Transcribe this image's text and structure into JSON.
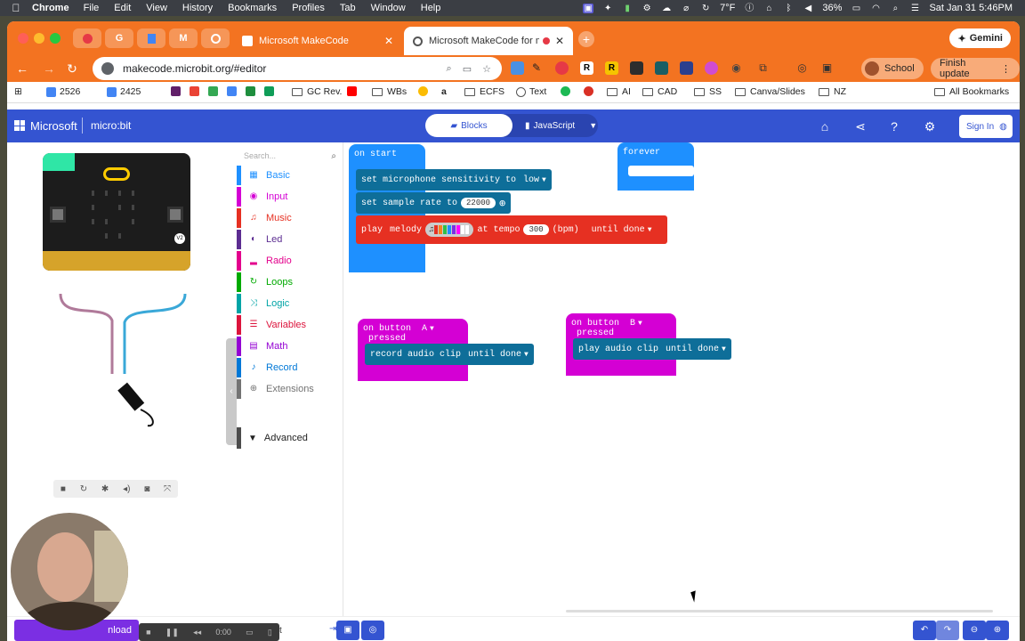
{
  "menubar": {
    "app": "Chrome",
    "menus": [
      "File",
      "Edit",
      "View",
      "History",
      "Bookmarks",
      "Profiles",
      "Tab",
      "Window",
      "Help"
    ],
    "weather": "7°F",
    "battery": "36%",
    "datetime": "Sat Jan 31  5:46PM"
  },
  "tabs": [
    {
      "label": "Microsoft MakeCode",
      "active": false
    },
    {
      "label": "Microsoft MakeCode for m",
      "active": true
    }
  ],
  "gemini_label": "Gemini",
  "address": {
    "url": "makecode.microbit.org/#editor",
    "profile_label": "School",
    "update_label": "Finish update"
  },
  "bookmarks": [
    {
      "label": "2526"
    },
    {
      "label": "2425"
    },
    {
      "label": "GC Rev."
    },
    {
      "label": "WBs"
    },
    {
      "label": "ECFS"
    },
    {
      "label": "Text"
    },
    {
      "label": "AI"
    },
    {
      "label": "CAD"
    },
    {
      "label": "SS"
    },
    {
      "label": "Canva/Slides"
    },
    {
      "label": "NZ"
    },
    {
      "label": "All Bookmarks"
    }
  ],
  "makecode": {
    "brand": "Microsoft",
    "product": "micro:bit",
    "blocks_label": "Blocks",
    "js_label": "JavaScript",
    "signin_label": "Sign In"
  },
  "toolbox": {
    "search_placeholder": "Search...",
    "categories": [
      {
        "label": "Basic",
        "color": "#1e90ff"
      },
      {
        "label": "Input",
        "color": "#d400d4"
      },
      {
        "label": "Music",
        "color": "#e63022"
      },
      {
        "label": "Led",
        "color": "#5c2d91"
      },
      {
        "label": "Radio",
        "color": "#e3008c"
      },
      {
        "label": "Loops",
        "color": "#00aa00"
      },
      {
        "label": "Logic",
        "color": "#00a4a6"
      },
      {
        "label": "Variables",
        "color": "#dc143c"
      },
      {
        "label": "Math",
        "color": "#9400d3"
      },
      {
        "label": "Record",
        "color": "#0078d7"
      },
      {
        "label": "Extensions",
        "color": "#737373"
      }
    ],
    "advanced_label": "Advanced"
  },
  "blocks": {
    "on_start": "on start",
    "mic_sensitivity": "set microphone sensitivity to",
    "mic_value": "low",
    "sample_rate": "set sample rate to",
    "sample_value": "22000",
    "play": "play",
    "melody": "melody",
    "at_tempo": "at tempo",
    "tempo_value": "300",
    "bpm": "(bpm)",
    "until_done": "until done",
    "forever": "forever",
    "on_button_a": "on button",
    "button_a": "A",
    "pressed": "pressed",
    "record_clip": "record audio clip",
    "on_button_b": "on button",
    "button_b": "B",
    "play_clip": "play audio clip"
  },
  "bottombar": {
    "download_label": "nload",
    "rec_time": "0:00",
    "project_name": "t"
  },
  "colors": {
    "chrome_orange": "#f37321",
    "makecode_blue": "#3454d1",
    "loops_green": "#00aa00"
  }
}
